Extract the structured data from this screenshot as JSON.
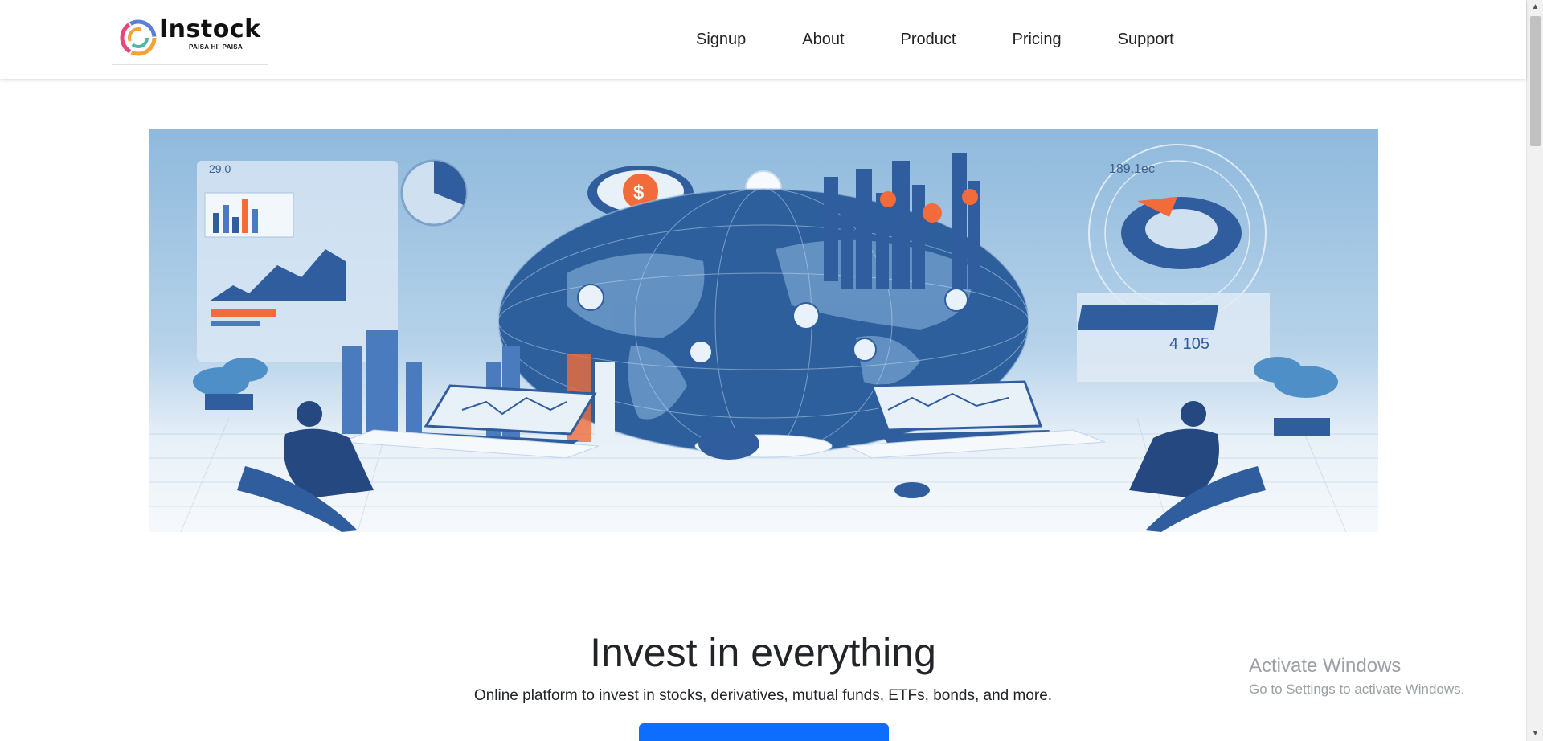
{
  "brand": {
    "name": "Instock",
    "tagline": "PAISA HI! PAISA"
  },
  "nav": {
    "items": [
      {
        "label": "Signup"
      },
      {
        "label": "About"
      },
      {
        "label": "Product"
      },
      {
        "label": "Pricing"
      },
      {
        "label": "Support"
      }
    ]
  },
  "hero": {
    "image_alt": "illustration-global-investing-dashboard",
    "labels": {
      "top_left_number": "29.0",
      "top_right_number": "189.1ec",
      "panel_number": "4 105",
      "dollar_symbol": "$"
    }
  },
  "main": {
    "headline": "Invest in everything",
    "subline": "Online platform to invest in stocks, derivatives, mutual funds, ETFs, bonds, and more."
  },
  "watermark": {
    "title": "Activate Windows",
    "subtitle": "Go to Settings to activate Windows."
  },
  "colors": {
    "primary": "#0d6efd",
    "hero_blue": "#2f5d9e",
    "accent_orange": "#f26b3a"
  }
}
